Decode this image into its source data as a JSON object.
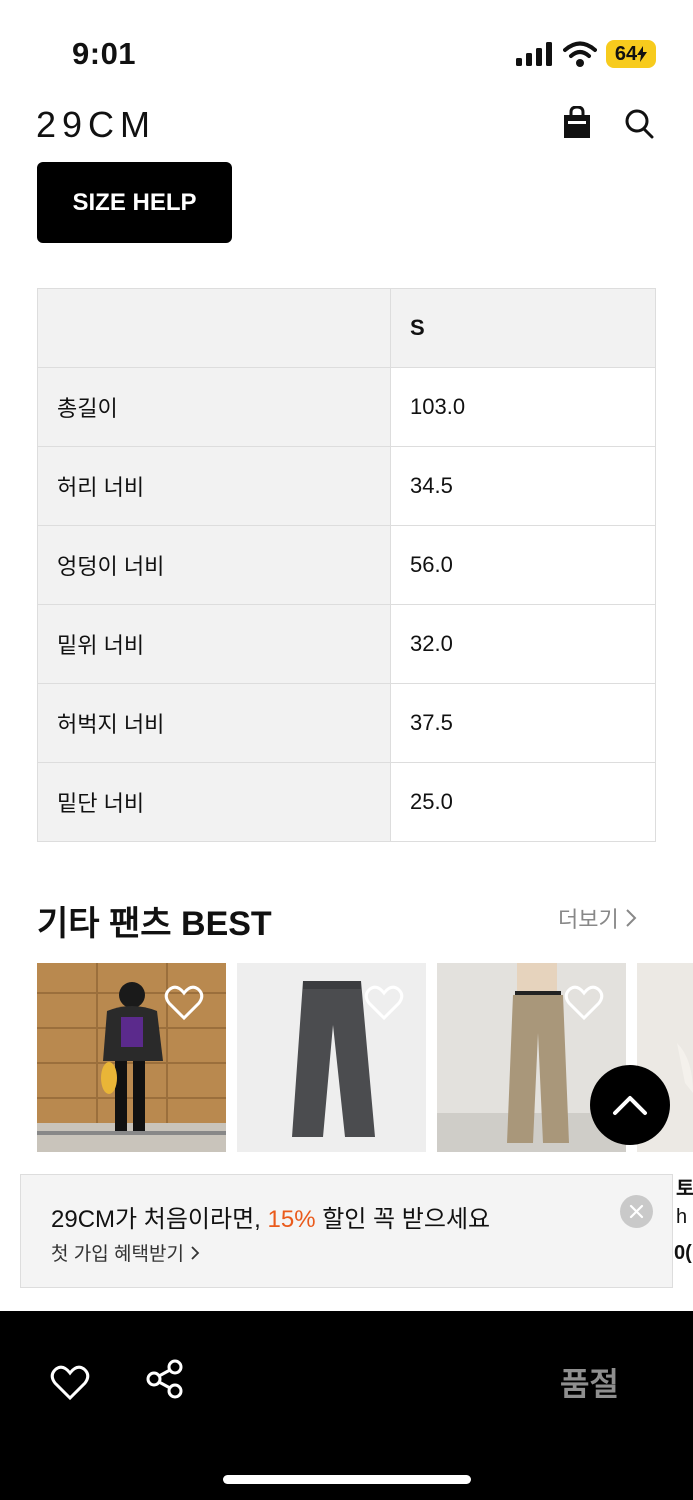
{
  "status_bar": {
    "time": "9:01",
    "battery": "64"
  },
  "header": {
    "logo": "29CM",
    "icons": [
      "shopping-bag-icon",
      "search-icon"
    ]
  },
  "size_help_label": "SIZE HELP",
  "size_table": {
    "header": [
      "",
      "S"
    ],
    "rows": [
      {
        "label": "총길이",
        "value": "103.0"
      },
      {
        "label": "허리 너비",
        "value": "34.5"
      },
      {
        "label": "엉덩이 너비",
        "value": "56.0"
      },
      {
        "label": "밑위 너비",
        "value": "32.0"
      },
      {
        "label": "허벅지 너비",
        "value": "37.5"
      },
      {
        "label": "밑단 너비",
        "value": "25.0"
      }
    ]
  },
  "best_section": {
    "title": "기타 팬츠 BEST",
    "more_label": "더보기",
    "partial_texts": [
      "토",
      "h",
      "0("
    ]
  },
  "promo": {
    "title_prefix": "29CM가 처음이라면, ",
    "highlight": "15%",
    "title_suffix": " 할인 꼭 받으세요",
    "sub_label": "첫 가입 혜택받기",
    "highlight_color": "#ea5a1b"
  },
  "bottom_bar": {
    "soldout_label": "품절"
  }
}
